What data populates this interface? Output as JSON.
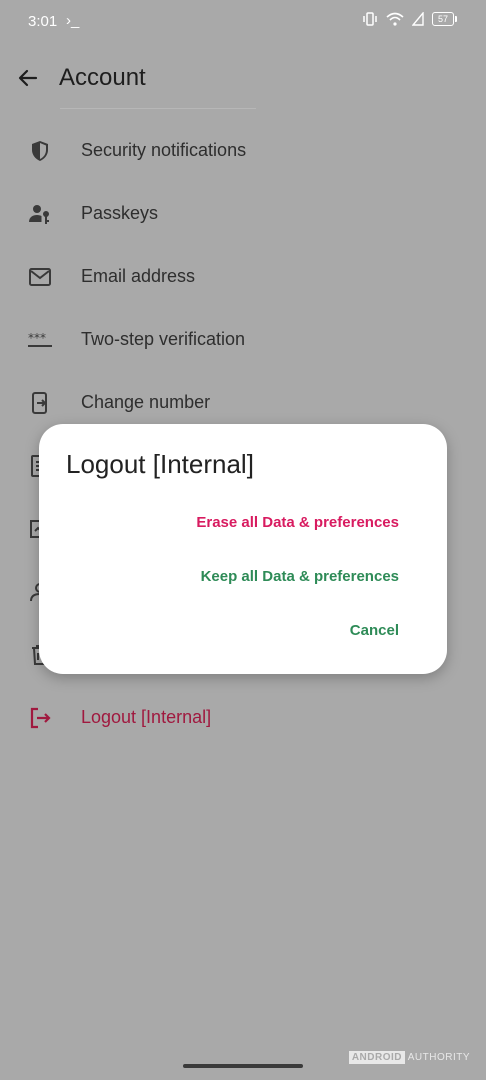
{
  "status_bar": {
    "time": "3:01",
    "terminal_glyph": "›_",
    "battery": "57"
  },
  "app_bar": {
    "title": "Account"
  },
  "menu": {
    "items": [
      {
        "label": "Security notifications",
        "icon": "shield-icon"
      },
      {
        "label": "Passkeys",
        "icon": "person-key-icon"
      },
      {
        "label": "Email address",
        "icon": "email-icon"
      },
      {
        "label": "Two-step verification",
        "icon": "password-dots-icon"
      },
      {
        "label": "Change number",
        "icon": "phone-transfer-icon"
      },
      {
        "label": "",
        "icon": "document-icon"
      },
      {
        "label": "",
        "icon": "archive-icon"
      },
      {
        "label": "",
        "icon": "person-icon"
      },
      {
        "label": "",
        "icon": "trash-icon"
      },
      {
        "label": "Logout [Internal]",
        "icon": "logout-icon"
      }
    ]
  },
  "dialog": {
    "title": "Logout [Internal]",
    "erase_label": "Erase all Data & preferences",
    "keep_label": "Keep all Data & preferences",
    "cancel_label": "Cancel"
  },
  "watermark": {
    "box_text": "ANDROID",
    "text": "AUTHORITY"
  },
  "colors": {
    "scrim_background": "#a9a9a9",
    "logout_red": "#a0193f",
    "erase_pink": "#d81b60",
    "action_green": "#2e8b57"
  }
}
